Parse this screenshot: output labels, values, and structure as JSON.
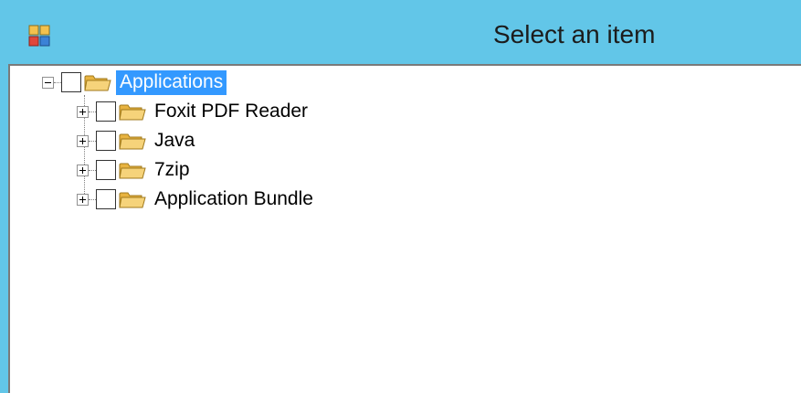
{
  "window": {
    "title": "Select an item"
  },
  "tree": {
    "root": {
      "label": "Applications",
      "expanded": true,
      "checked": false,
      "selected": true,
      "icon": "folder-icon"
    },
    "children": [
      {
        "label": "Foxit PDF Reader",
        "expanded": false,
        "checked": false,
        "icon": "folder-icon"
      },
      {
        "label": "Java",
        "expanded": false,
        "checked": false,
        "icon": "folder-icon"
      },
      {
        "label": "7zip",
        "expanded": false,
        "checked": false,
        "icon": "folder-icon"
      },
      {
        "label": "Application Bundle",
        "expanded": false,
        "checked": false,
        "icon": "folder-icon"
      }
    ]
  },
  "colors": {
    "titlebar": "#62c6e8",
    "selection": "#3399ff",
    "folder": "#f0c050"
  }
}
